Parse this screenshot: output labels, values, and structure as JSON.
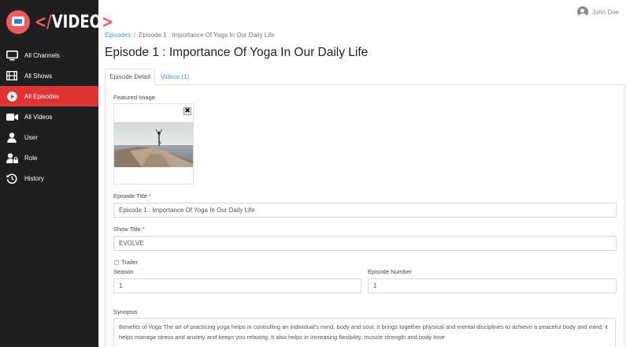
{
  "app": {
    "logo_prefix": "</",
    "logo_word": "VIDEO",
    "logo_suffix": ">"
  },
  "sidebar": {
    "items": [
      {
        "label": "All Channels",
        "icon": "monitor-icon",
        "active": false
      },
      {
        "label": "All Shows",
        "icon": "film-icon",
        "active": false
      },
      {
        "label": "All Episodes",
        "icon": "play-circle-icon",
        "active": true
      },
      {
        "label": "All Videos",
        "icon": "video-camera-icon",
        "active": false
      },
      {
        "label": "User",
        "icon": "user-icon",
        "active": false
      },
      {
        "label": "Role",
        "icon": "user-lock-icon",
        "active": false
      },
      {
        "label": "History",
        "icon": "history-icon",
        "active": false
      }
    ]
  },
  "header": {
    "user_name": "John Doe"
  },
  "breadcrumb": {
    "root": "Episodes",
    "separator": "/",
    "current": "Episode 1 : Importance Of Yoga In Our Daily Life"
  },
  "page": {
    "title": "Episode 1 : Importance Of Yoga In Our Daily Life"
  },
  "tabs": {
    "detail": "Episode Detail",
    "videos": "Videos (1)"
  },
  "form": {
    "featured_image_label": "Featured Image",
    "close_glyph": "✖",
    "episode_title_label": "Episode Title",
    "required_mark": "*",
    "episode_title_value": "Episode 1 :  Importance Of Yoga In Our Daily Life",
    "show_title_label": "Show Title",
    "show_title_value": "EVOLVE",
    "trailer_label": "Trailer",
    "trailer_checked": false,
    "season_label": "Season",
    "season_value": "1",
    "episode_number_label": "Episode Number",
    "episode_number_value": "1",
    "synopsis_label": "Synopsis",
    "synopsis_value": "Benefits of Yoga The art of practicing yoga helps in controlling an individual's mind, body and soul. It brings together physical and mental disciplines to achieve a peaceful body and mind; it helps manage stress and anxiety and keeps you relaxing. It also helps in increasing flexibility, muscle strength and body tone"
  },
  "colors": {
    "sidebar_bg": "#1e1f21",
    "active_item": "#e03333",
    "link": "#4a90d9",
    "logo_accent": "#f15b5b"
  }
}
